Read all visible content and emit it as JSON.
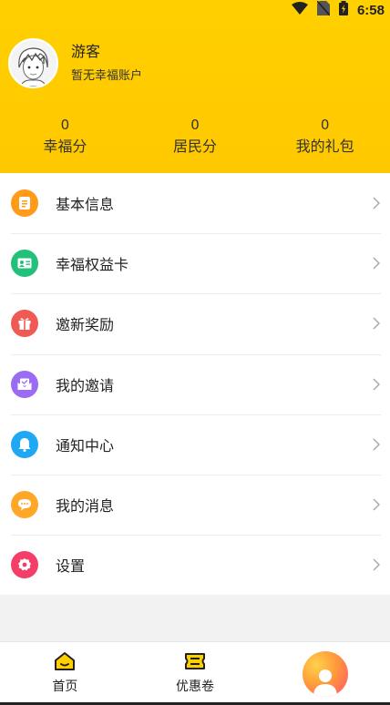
{
  "status": {
    "time": "6:58"
  },
  "user": {
    "name": "游客",
    "subtitle": "暂无幸福账户"
  },
  "stats": [
    {
      "value": "0",
      "label": "幸福分"
    },
    {
      "value": "0",
      "label": "居民分"
    },
    {
      "value": "0",
      "label": "我的礼包"
    }
  ],
  "menu": [
    {
      "label": "基本信息",
      "icon": "document-icon",
      "color": "#ff9a1a"
    },
    {
      "label": "幸福权益卡",
      "icon": "id-card-icon",
      "color": "#22c07a"
    },
    {
      "label": "邀新奖励",
      "icon": "gift-icon",
      "color": "#f05a55"
    },
    {
      "label": "我的邀请",
      "icon": "envelope-icon",
      "color": "#9a6cf2"
    },
    {
      "label": "通知中心",
      "icon": "bell-icon",
      "color": "#1fa9f4"
    },
    {
      "label": "我的消息",
      "icon": "chat-bubble-icon",
      "color": "#ffa726"
    },
    {
      "label": "设置",
      "icon": "gear-icon",
      "color": "#f43d67"
    }
  ],
  "tabs": [
    {
      "label": "首页",
      "icon": "home-icon"
    },
    {
      "label": "优惠卷",
      "icon": "coupon-icon"
    },
    {
      "label": "",
      "icon": "profile-icon"
    }
  ],
  "colors": {
    "header": "#ffd000",
    "accent": "#ffc800"
  }
}
